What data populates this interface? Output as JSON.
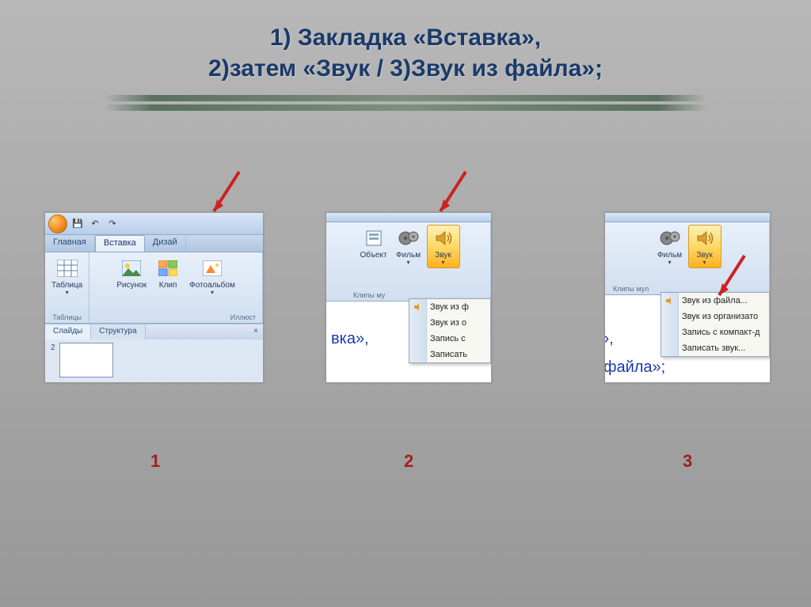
{
  "title_line1": "1) Закладка «Вставка»,",
  "title_line2": "2)затем  «Звук / 3)Звук из файла»;",
  "qat": {
    "save": "💾",
    "undo": "↶",
    "redo": "↷"
  },
  "tabs": {
    "home": "Главная",
    "insert": "Вставка",
    "design": "Дизай"
  },
  "groups": {
    "table": "Таблица",
    "tables": "Таблицы",
    "picture": "Рисунок",
    "clip": "Клип",
    "album": "Фотоальбом",
    "illus": "Иллюст"
  },
  "footer_tabs": {
    "slides": "Слайды",
    "structure": "Структура",
    "close": "×"
  },
  "thumb_num": "2",
  "media": {
    "object": "Объект",
    "film": "Фильм",
    "sound": "Звук",
    "clips": "Клипы му",
    "clips2": "Клипы мул"
  },
  "menu": {
    "from_file_short": "Звук из ф",
    "from_org_short": "Звук из о",
    "record_cd_short": "Запись с",
    "record_short": "Записать",
    "from_file": "Звук из файла...",
    "from_org": "Звук из организато",
    "record_cd": "Запись с компакт-д",
    "record": "Записать звук..."
  },
  "under": {
    "s2": "вка»,",
    "s3": "файла»;"
  },
  "steps": {
    "n1": "1",
    "n2": "2",
    "n3": "3"
  }
}
